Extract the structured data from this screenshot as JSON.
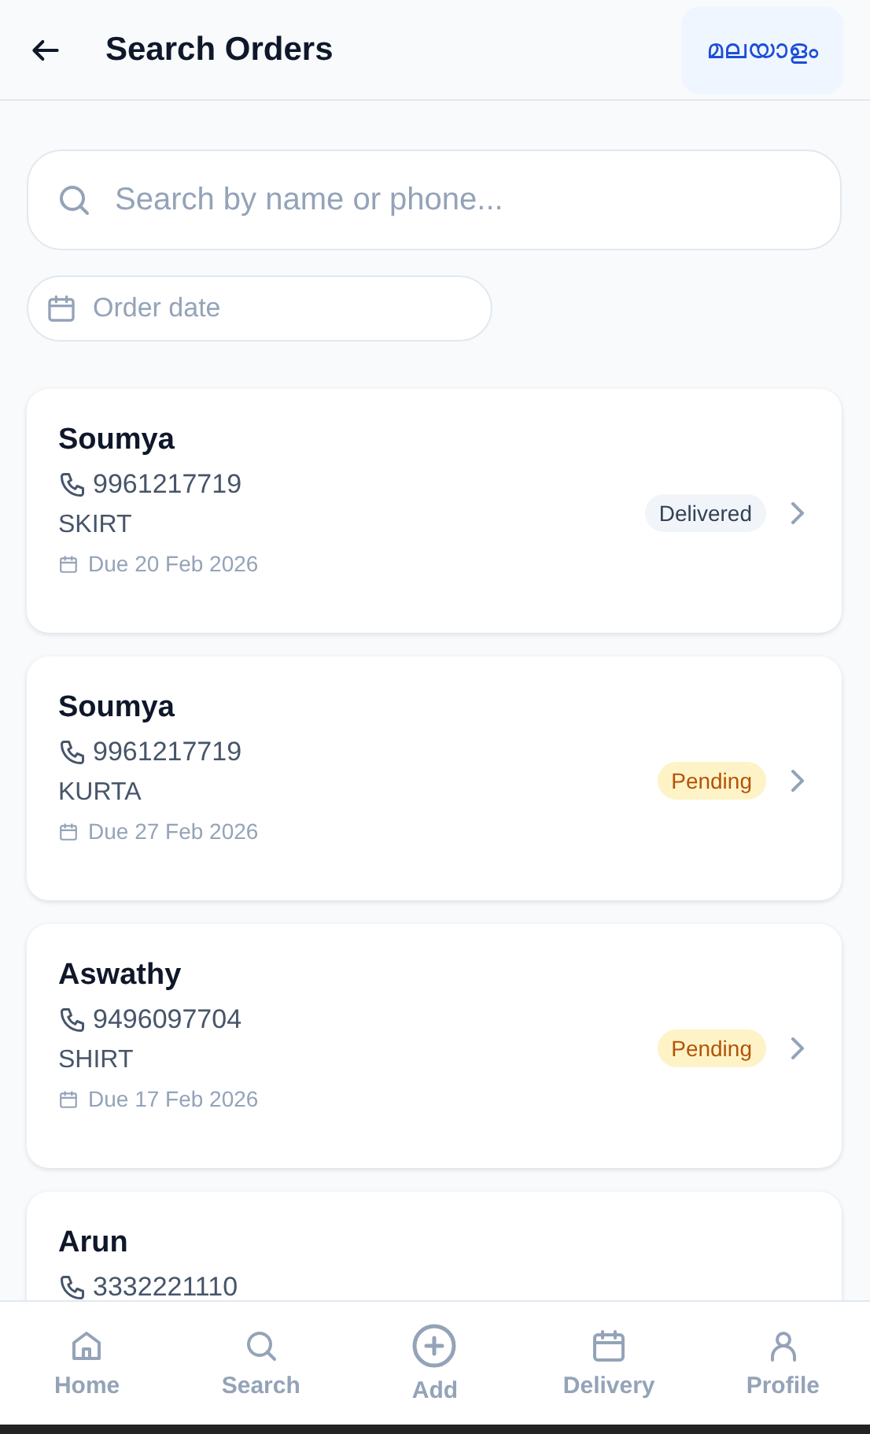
{
  "header": {
    "title": "Search Orders",
    "language_button": "മലയാളം"
  },
  "search": {
    "placeholder": "Search by name or phone..."
  },
  "date_filter": {
    "placeholder": "Order date"
  },
  "orders": [
    {
      "name": "Soumya",
      "phone": "9961217719",
      "item": "SKIRT",
      "due": "Due 20 Feb 2026",
      "status": {
        "label": "Delivered",
        "kind": "delivered"
      }
    },
    {
      "name": "Soumya",
      "phone": "9961217719",
      "item": "KURTA",
      "due": "Due 27 Feb 2026",
      "status": {
        "label": "Pending",
        "kind": "pending"
      }
    },
    {
      "name": "Aswathy",
      "phone": "9496097704",
      "item": "SHIRT",
      "due": "Due 17 Feb 2026",
      "status": {
        "label": "Pending",
        "kind": "pending"
      }
    },
    {
      "name": "Arun",
      "phone": "3332221110"
    }
  ],
  "nav": [
    {
      "kind": "home",
      "label": "Home"
    },
    {
      "kind": "search",
      "label": "Search"
    },
    {
      "kind": "add",
      "label": "Add"
    },
    {
      "kind": "delivery",
      "label": "Delivery"
    },
    {
      "kind": "profile",
      "label": "Profile"
    }
  ]
}
